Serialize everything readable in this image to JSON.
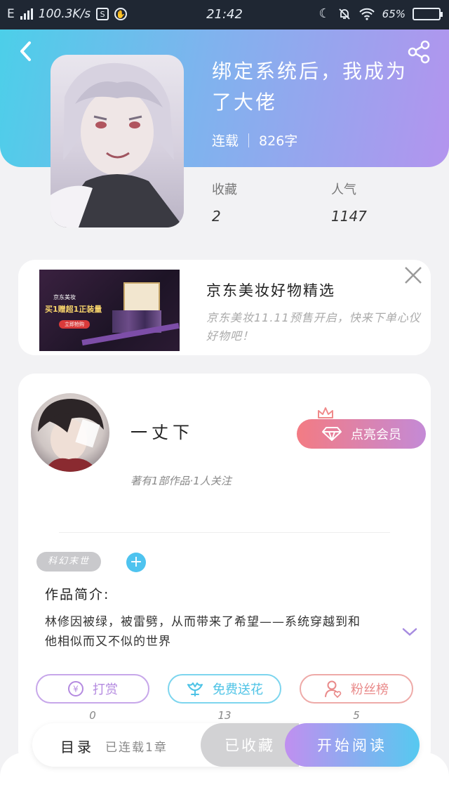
{
  "status_bar": {
    "network": "E",
    "speed": "100.3K/s",
    "sq_icon_letter": "S",
    "time": "21:42",
    "battery": "65%"
  },
  "book": {
    "title": "绑定系统后，我成为了大佬",
    "status": "连载",
    "word_count": "826字",
    "favorites_label": "收藏",
    "favorites_value": "2",
    "popularity_label": "人气",
    "popularity_value": "1147"
  },
  "ad": {
    "title": "京东美妆好物精选",
    "description": "京东美妆11.11预售开启，快来下单心仪好物吧！",
    "image_lines": [
      "京东美妆",
      "买1赠超1正装量",
      "立即抢购"
    ]
  },
  "author": {
    "name": "一丈下",
    "subtitle": "著有1部作品·1人关注",
    "vip_button": "点亮会员"
  },
  "tags": [
    {
      "label": "科幻末世"
    }
  ],
  "tag_add": "+",
  "intro": {
    "label": "作品简介:",
    "text": "林修因被绿，被雷劈，从而带来了希望——系统穿越到和他相似而又不似的世界"
  },
  "actions": [
    {
      "label": "打赏",
      "count": "0",
      "color": "#b48ae0"
    },
    {
      "label": "免费送花",
      "count": "13",
      "color": "#4ec3e6"
    },
    {
      "label": "粉丝榜",
      "count": "5",
      "color": "#e98a8a"
    }
  ],
  "bottom": {
    "catalog": "目录",
    "chapters": "已连载1章",
    "collected": "已收藏",
    "read": "开始阅读"
  }
}
